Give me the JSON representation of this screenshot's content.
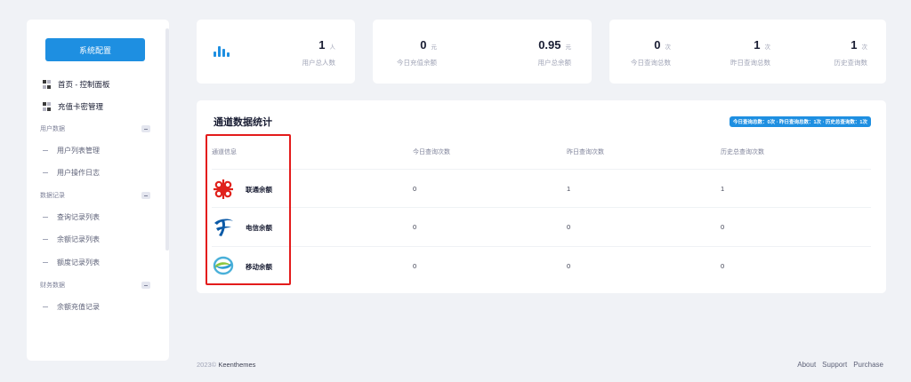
{
  "sidebar": {
    "config_button": "系统配置",
    "top_items": [
      {
        "label": "首页 - 控制面板"
      },
      {
        "label": "充值卡密管理"
      }
    ],
    "sections": [
      {
        "title": "用户数据",
        "items": [
          "用户列表管理",
          "用户操作日志"
        ]
      },
      {
        "title": "数据记录",
        "items": [
          "查询记录列表",
          "余额记录列表",
          "额度记录列表"
        ]
      },
      {
        "title": "财务数据",
        "items": [
          "余额充值记录"
        ]
      }
    ]
  },
  "stats": {
    "users": {
      "value": "1",
      "unit": "人",
      "label": "用户总人数"
    },
    "today_recharge": {
      "value": "0",
      "unit": "元",
      "label": "今日充值余额"
    },
    "user_balance": {
      "value": "0.95",
      "unit": "元",
      "label": "用户总余额"
    },
    "today_queries": {
      "value": "0",
      "unit": "次",
      "label": "今日查询总数"
    },
    "yesterday_queries": {
      "value": "1",
      "unit": "次",
      "label": "昨日查询总数"
    },
    "history_queries": {
      "value": "1",
      "unit": "次",
      "label": "历史查询数"
    }
  },
  "channel_table": {
    "title": "通道数据统计",
    "badge": "今日查询总数：0次 · 昨日查询总数：1次 · 历史总查询数：1次",
    "columns": [
      "通道信息",
      "今日查询次数",
      "昨日查询次数",
      "历史总查询次数"
    ],
    "rows": [
      {
        "name": "联通余额",
        "logo": "china-unicom-logo",
        "today": "0",
        "yesterday": "1",
        "history": "1"
      },
      {
        "name": "电信余额",
        "logo": "china-telecom-logo",
        "today": "0",
        "yesterday": "0",
        "history": "0"
      },
      {
        "name": "移动余额",
        "logo": "china-mobile-logo",
        "today": "0",
        "yesterday": "0",
        "history": "0"
      }
    ]
  },
  "footer": {
    "year": "2023©",
    "brand": "Keenthemes",
    "links": [
      "About",
      "Support",
      "Purchase"
    ]
  },
  "colors": {
    "accent": "#1e8fe1",
    "highlight": "#e31b1b",
    "background": "#f0f2f6"
  }
}
